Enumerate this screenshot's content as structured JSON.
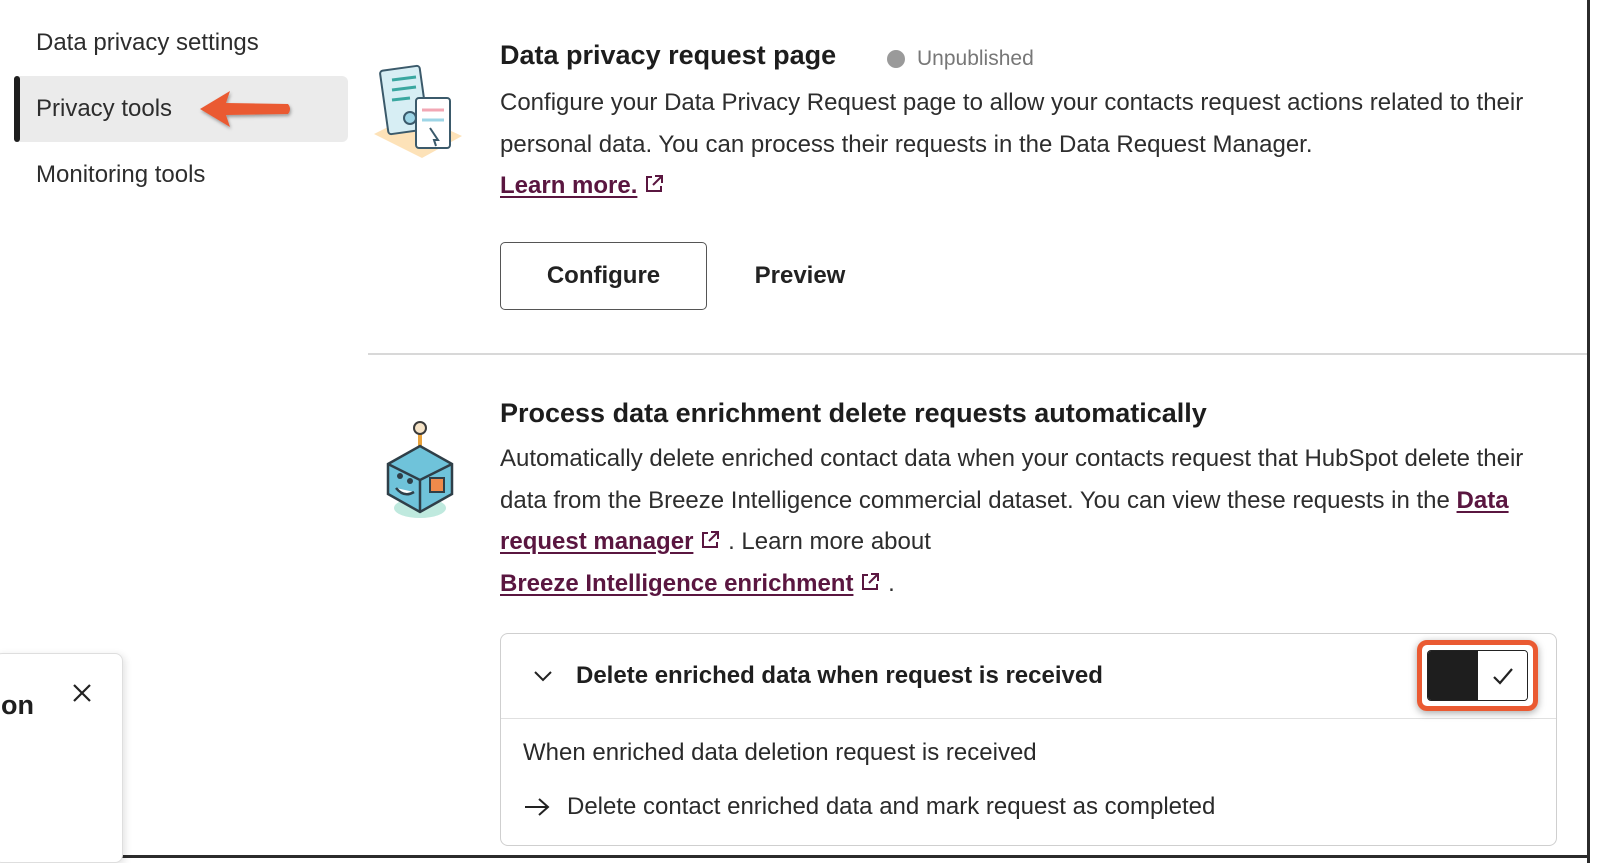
{
  "sidebar": {
    "items": [
      {
        "label": "Data privacy settings"
      },
      {
        "label": "Privacy tools"
      },
      {
        "label": "Monitoring tools"
      }
    ]
  },
  "privacy_request": {
    "title": "Data privacy request page",
    "status": "Unpublished",
    "description": "Configure your Data Privacy Request page to allow your contacts request actions related to their personal data. You can process their requests in the Data Request Manager.",
    "learn_more": "Learn more.",
    "configure_label": "Configure",
    "preview_label": "Preview"
  },
  "enrichment": {
    "title": "Process data enrichment delete requests automatically",
    "description_part1": "Automatically delete enriched contact data when your contacts request that HubSpot delete their data from the Breeze Intelligence commercial dataset. You can view these requests in the",
    "link1": "Data request manager",
    "description_part2": ". Learn more about",
    "link2": "Breeze Intelligence enrichment",
    "description_part3": "."
  },
  "accordion": {
    "title": "Delete enriched data when request is received",
    "trigger": "When enriched data deletion request is received",
    "action": "Delete contact enriched data and mark request as completed",
    "toggle_on": true
  },
  "panel": {
    "text": "on"
  },
  "colors": {
    "link": "#5a1640",
    "annotation": "#ea5a32",
    "active_bg": "#ebebeb"
  }
}
